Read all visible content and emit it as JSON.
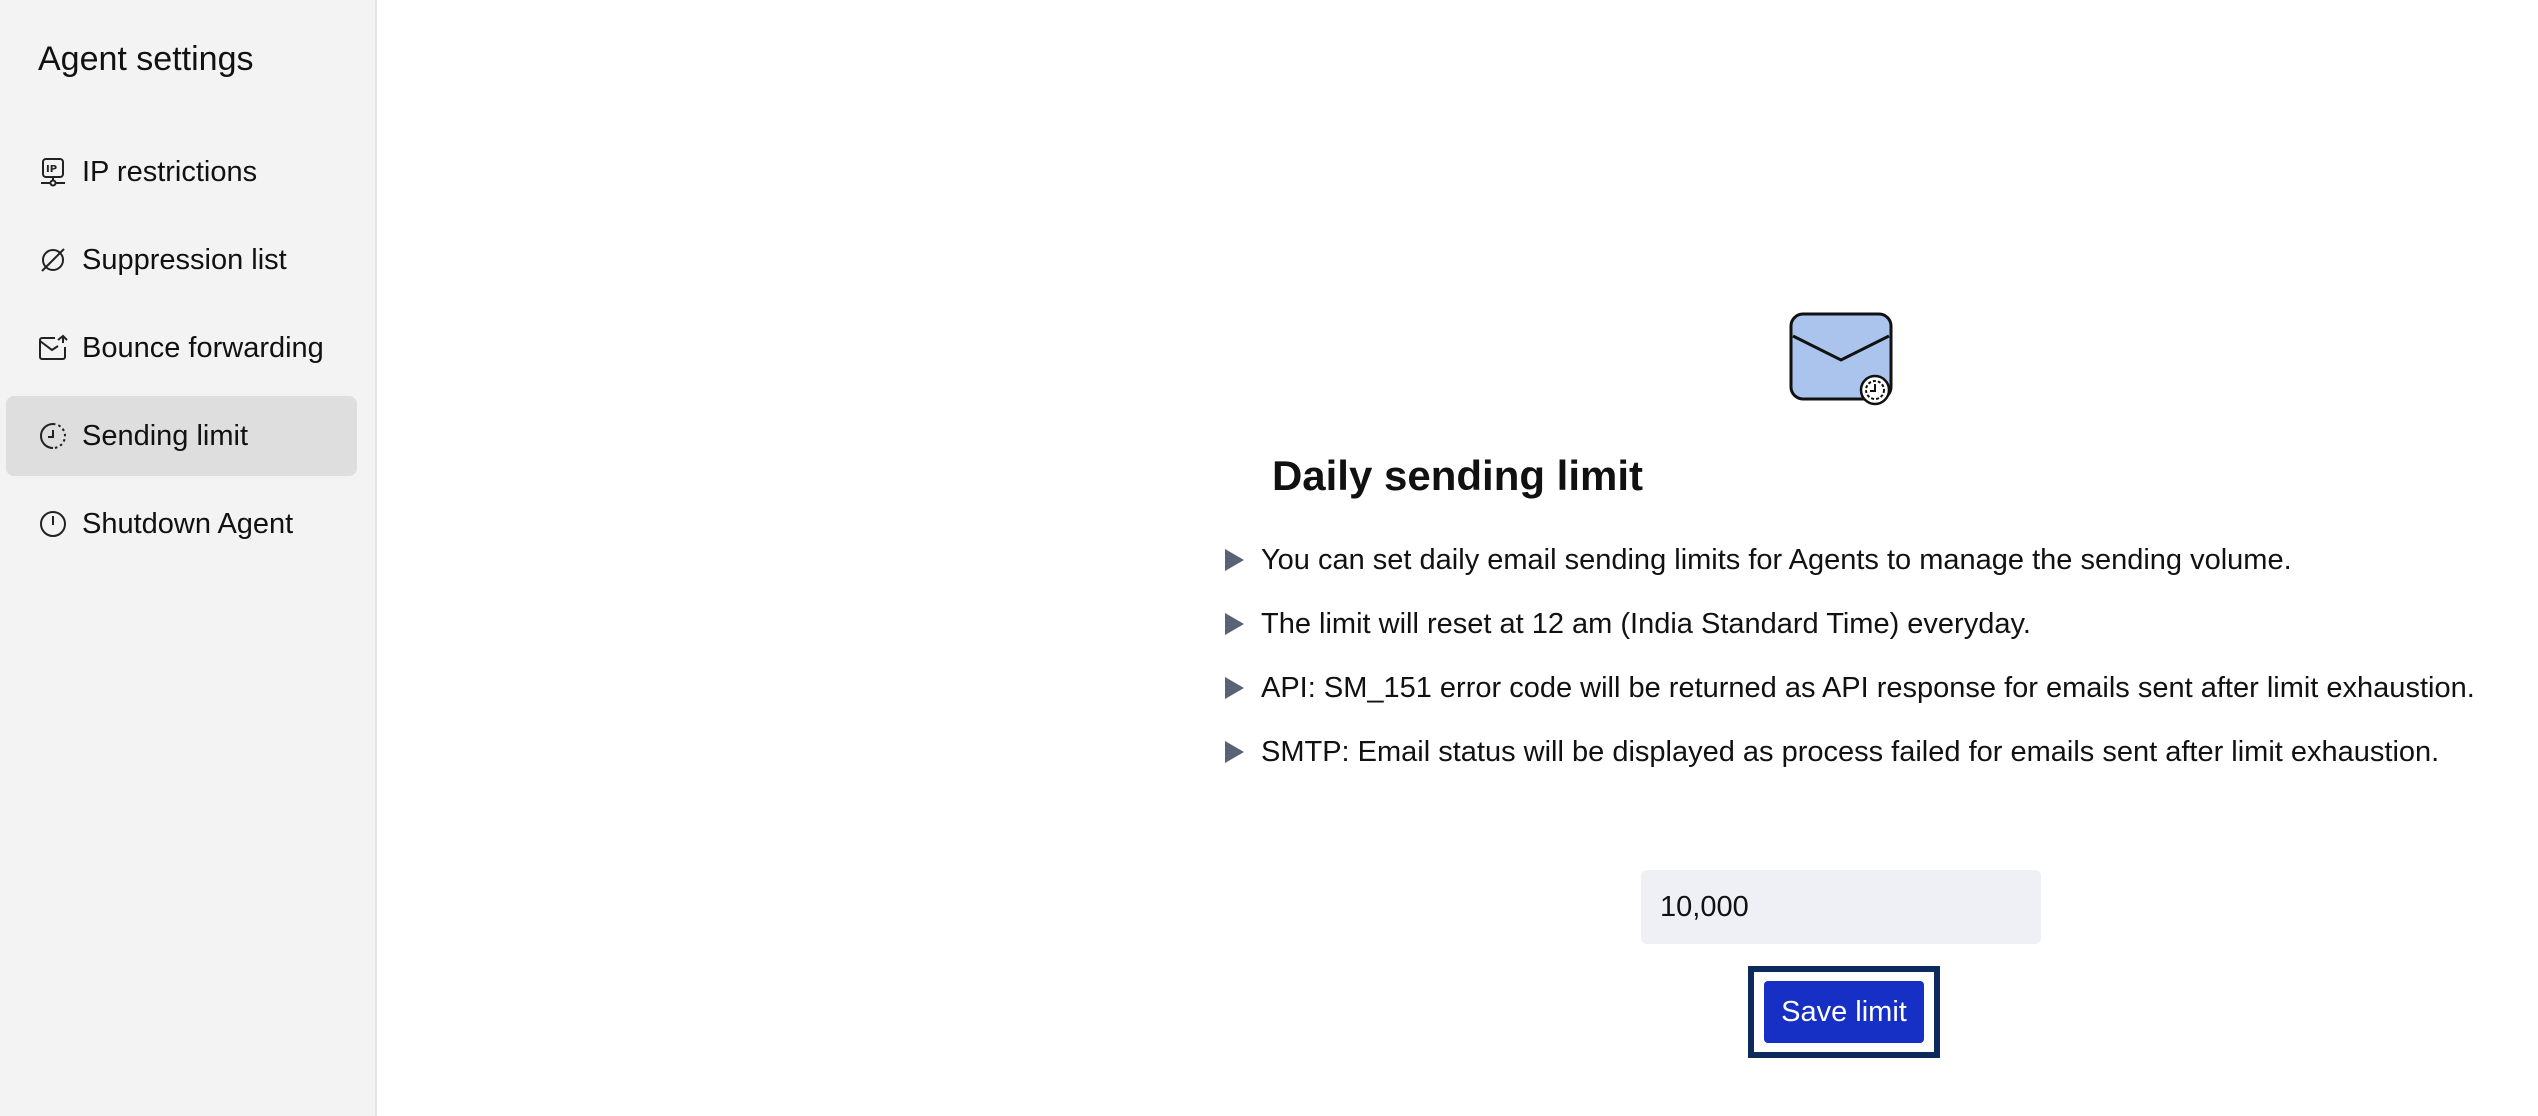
{
  "sidebar": {
    "title": "Agent settings",
    "items": [
      {
        "label": "IP restrictions",
        "icon": "ip-icon"
      },
      {
        "label": "Suppression list",
        "icon": "suppression-icon"
      },
      {
        "label": "Bounce forwarding",
        "icon": "bounce-forward-icon"
      },
      {
        "label": "Sending limit",
        "icon": "sending-limit-icon",
        "active": true
      },
      {
        "label": "Shutdown Agent",
        "icon": "power-icon"
      }
    ]
  },
  "main": {
    "icon": "envelope-clock-icon",
    "heading": "Daily sending limit",
    "bullets": [
      "You can set daily email sending limits for Agents to manage the sending volume.",
      "The limit will reset at 12 am (India Standard Time) everyday.",
      "API: SM_151 error code will be returned as API response for emails sent after limit exhaustion.",
      "SMTP: Email status will be displayed as process failed for emails sent after limit exhaustion."
    ],
    "limit_value": "10,000",
    "save_label": "Save limit"
  },
  "colors": {
    "accent": "#1630c5",
    "focus_ring": "#0d2a5c",
    "sidebar_bg": "#f3f3f3",
    "active_item_bg": "#dedede",
    "input_bg": "#eff0f5",
    "envelope_fill": "#aac4ee"
  }
}
